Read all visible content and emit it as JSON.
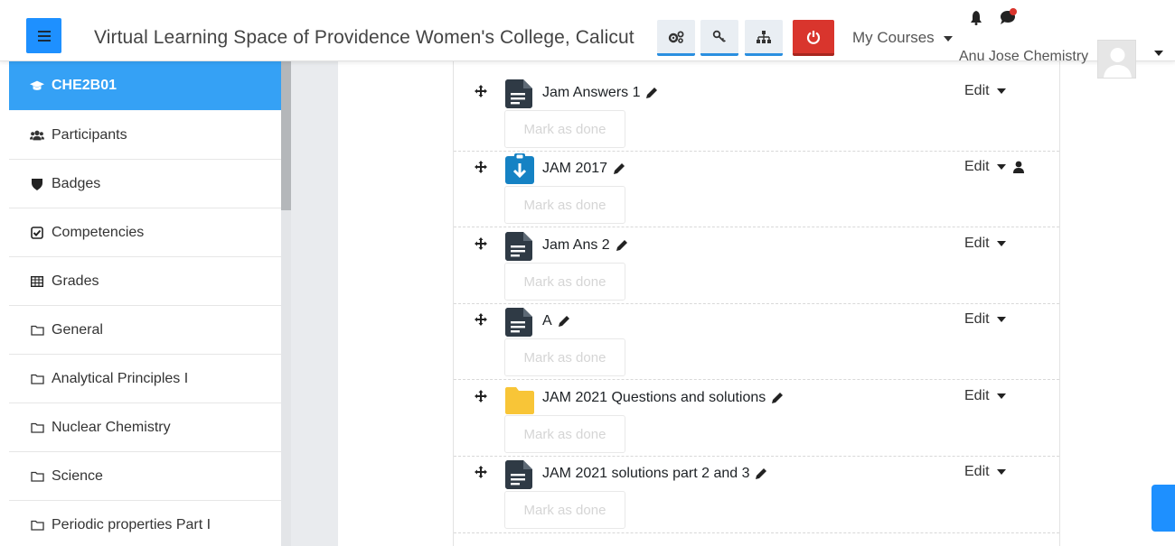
{
  "header": {
    "site_title": "Virtual Learning Space of Providence Women's College, Calicut",
    "my_courses_label": "My Courses",
    "user_name": "Anu Jose Chemistry"
  },
  "sidebar": {
    "items": [
      {
        "label": "CHE2B01",
        "icon": "graduation-cap-icon",
        "active": true
      },
      {
        "label": "Participants",
        "icon": "users-icon"
      },
      {
        "label": "Badges",
        "icon": "shield-icon"
      },
      {
        "label": "Competencies",
        "icon": "check-square-icon"
      },
      {
        "label": "Grades",
        "icon": "table-icon"
      },
      {
        "label": "General",
        "icon": "folder-icon"
      },
      {
        "label": "Analytical Principles I",
        "icon": "folder-icon"
      },
      {
        "label": "Nuclear Chemistry",
        "icon": "folder-icon"
      },
      {
        "label": "Science",
        "icon": "folder-icon"
      },
      {
        "label": "Periodic properties Part I",
        "icon": "folder-icon"
      }
    ]
  },
  "activities": [
    {
      "title": "Jam Answers 1",
      "icon": "page-icon",
      "edit_label": "Edit",
      "mark_label": "Mark as done"
    },
    {
      "title": "JAM 2017",
      "icon": "download-icon",
      "edit_label": "Edit",
      "mark_label": "Mark as done"
    },
    {
      "title": "Jam Ans 2",
      "icon": "page-icon",
      "edit_label": "Edit",
      "mark_label": "Mark as done"
    },
    {
      "title": "A",
      "icon": "page-icon",
      "edit_label": "Edit",
      "mark_label": "Mark as done"
    },
    {
      "title": "JAM 2021 Questions and solutions",
      "icon": "folder-icon",
      "edit_label": "Edit",
      "mark_label": "Mark as done"
    },
    {
      "title": "JAM 2021 solutions part 2 and 3",
      "icon": "page-icon",
      "edit_label": "Edit",
      "mark_label": "Mark as done"
    }
  ],
  "colors": {
    "primary": "#35a1f5",
    "danger": "#d9352d",
    "folder": "#f8c537",
    "resource_icon": "#2f3a45"
  }
}
